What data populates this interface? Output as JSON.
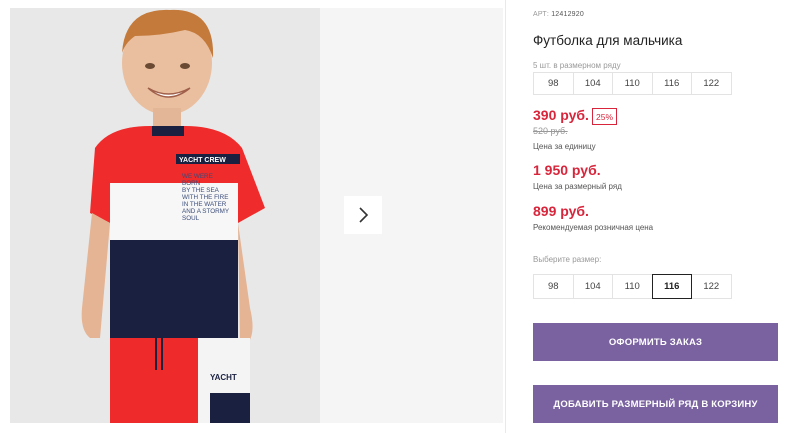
{
  "product": {
    "sku_label": "АРТ:",
    "sku": "12412920",
    "title": "Футболка для мальчика",
    "size_row_label": "5 шт. в размерном ряду",
    "size_row": [
      "98",
      "104",
      "110",
      "116",
      "122"
    ],
    "price": "390 руб.",
    "discount": "25%",
    "old_price": "520 руб.",
    "price_caption": "Цена за единицу",
    "row_price": "1 950 руб.",
    "row_price_caption": "Цена за размерный ряд",
    "rrp": "899 руб.",
    "rrp_caption": "Рекомендуемая розничная цена",
    "choose_size_label": "Выберите размер:",
    "sizes": [
      "98",
      "104",
      "110",
      "116",
      "122"
    ],
    "selected_size": "116"
  },
  "actions": {
    "order": "ОФОРМИТЬ ЗАКАЗ",
    "add_row": "ДОБАВИТЬ РАЗМЕРНЫЙ РЯД В КОРЗИНУ"
  },
  "photo": {
    "shirt_lines": [
      "WE WERE",
      "BORN",
      "BY THE SEA",
      "WITH THE FIRE",
      "IN THE WATER",
      "AND A STORMY",
      "SOUL"
    ],
    "shirt_tag": "YACHT CREW",
    "shorts_text": "YACHT"
  },
  "colors": {
    "accent": "#7a62a1",
    "price": "#d8253b"
  }
}
